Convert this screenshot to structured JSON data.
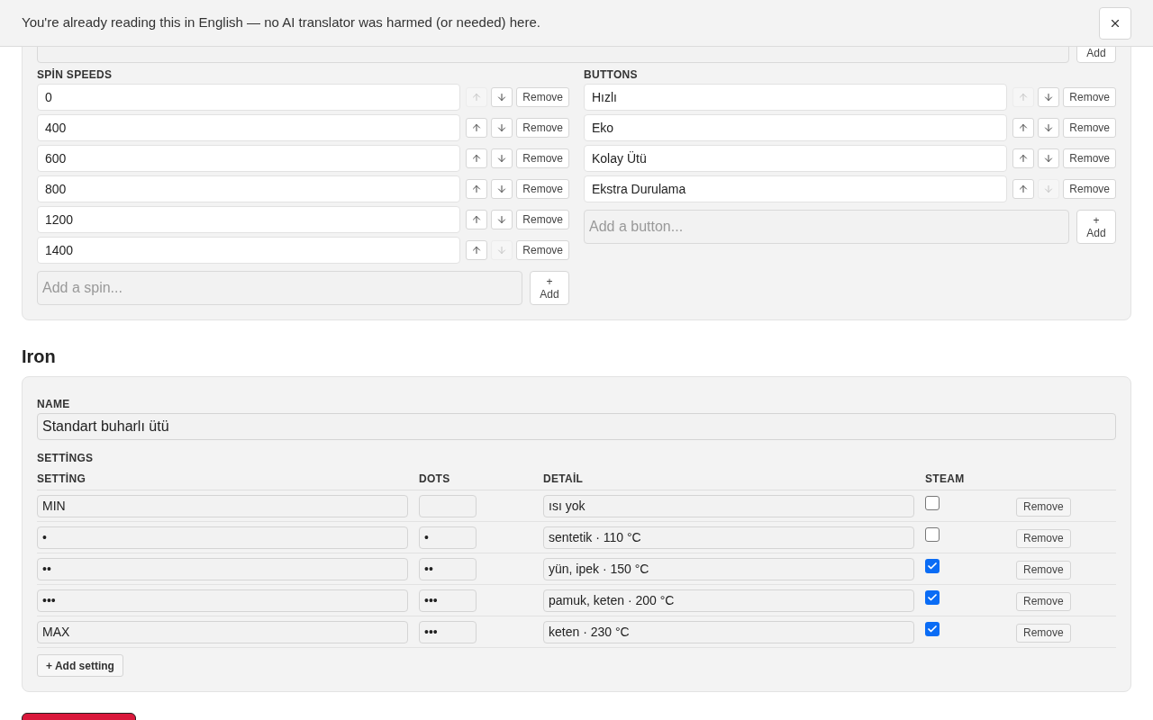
{
  "banner": {
    "text": "You're already reading this in English — no AI translator was harmed (or needed) here."
  },
  "programmes": {
    "add_button": "Add"
  },
  "spin_speeds": {
    "label": "SPİN SPEEDS",
    "items": [
      {
        "value": "0",
        "up_disabled": true,
        "down_disabled": false,
        "remove": "Remove"
      },
      {
        "value": "400",
        "up_disabled": false,
        "down_disabled": false,
        "remove": "Remove"
      },
      {
        "value": "600",
        "up_disabled": false,
        "down_disabled": false,
        "remove": "Remove"
      },
      {
        "value": "800",
        "up_disabled": false,
        "down_disabled": false,
        "remove": "Remove"
      },
      {
        "value": "1200",
        "up_disabled": false,
        "down_disabled": false,
        "remove": "Remove"
      },
      {
        "value": "1400",
        "up_disabled": false,
        "down_disabled": true,
        "remove": "Remove"
      }
    ],
    "add_placeholder": "Add a spin...",
    "add_plus": "+",
    "add_button": "Add"
  },
  "buttons": {
    "label": "BUTTONS",
    "items": [
      {
        "value": "Hızlı",
        "up_disabled": true,
        "down_disabled": false,
        "remove": "Remove"
      },
      {
        "value": "Eko",
        "up_disabled": false,
        "down_disabled": false,
        "remove": "Remove"
      },
      {
        "value": "Kolay Ütü",
        "up_disabled": false,
        "down_disabled": false,
        "remove": "Remove"
      },
      {
        "value": "Ekstra Durulama",
        "up_disabled": false,
        "down_disabled": true,
        "remove": "Remove"
      }
    ],
    "add_placeholder": "Add a button...",
    "add_plus": "+",
    "add_button": "Add"
  },
  "iron": {
    "heading": "Iron",
    "name_label": "NAME",
    "name_value": "Standart buharlı ütü",
    "settings_label": "SETTİNGS",
    "columns": [
      "SETTİNG",
      "DOTS",
      "DETAİL",
      "STEAM"
    ],
    "rows": [
      {
        "setting": "MIN",
        "detail": "ısı yok",
        "steam": false,
        "remove": "Remove"
      },
      {
        "setting": "•",
        "dots": "•",
        "detail": "sentetik · 110 °C",
        "steam": false,
        "remove": "Remove"
      },
      {
        "setting": "••",
        "dots": "••",
        "detail": "yün, ipek · 150 °C",
        "steam": true,
        "remove": "Remove"
      },
      {
        "setting": "•••",
        "dots": "•••",
        "detail": "pamuk, keten · 200 °C",
        "steam": true,
        "remove": "Remove"
      },
      {
        "setting": "MAX",
        "dots": "•••",
        "detail": "keten · 230 °C",
        "steam": true,
        "remove": "Remove"
      }
    ],
    "add_setting": "+ Add setting"
  }
}
